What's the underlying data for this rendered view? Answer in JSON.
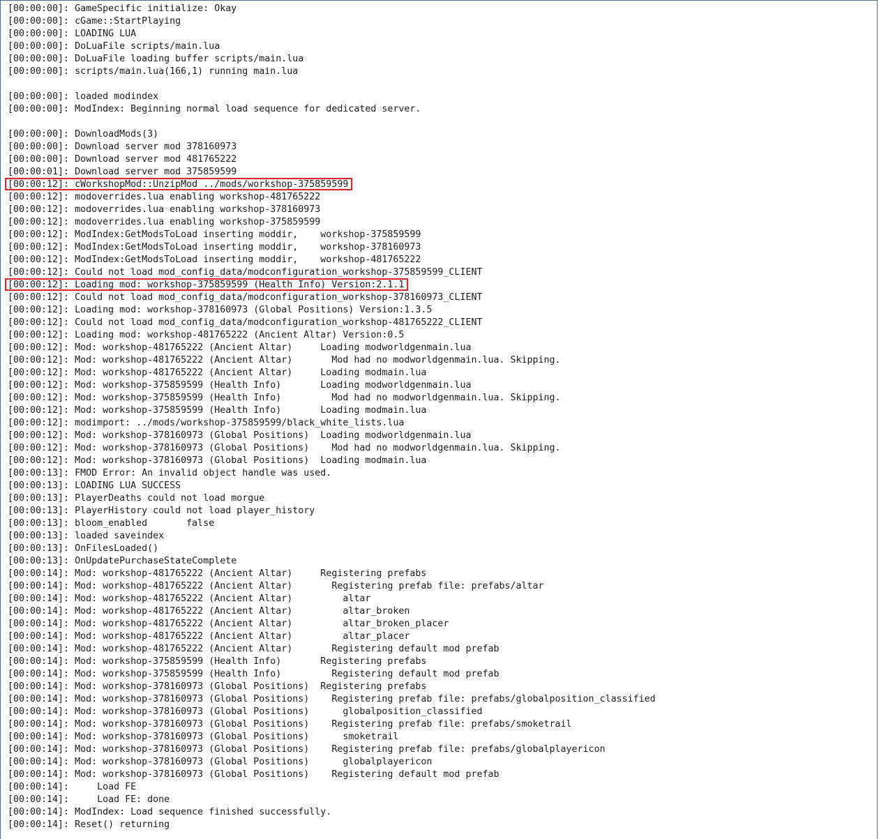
{
  "console": {
    "lines": [
      "[00:00:00]: GameSpecific initialize: Okay",
      "[00:00:00]: cGame::StartPlaying",
      "[00:00:00]: LOADING LUA",
      "[00:00:00]: DoLuaFile scripts/main.lua",
      "[00:00:00]: DoLuaFile loading buffer scripts/main.lua",
      "[00:00:00]: scripts/main.lua(166,1) running main.lua",
      "",
      "[00:00:00]: loaded modindex",
      "[00:00:00]: ModIndex: Beginning normal load sequence for dedicated server.",
      "",
      "[00:00:00]: DownloadMods(3)",
      "[00:00:00]: Download server mod 378160973",
      "[00:00:00]: Download server mod 481765222",
      "[00:00:01]: Download server mod 375859599",
      "[00:00:12]: cWorkshopMod::UnzipMod ../mods/workshop-375859599",
      "[00:00:12]: modoverrides.lua enabling workshop-481765222",
      "[00:00:12]: modoverrides.lua enabling workshop-378160973",
      "[00:00:12]: modoverrides.lua enabling workshop-375859599",
      "[00:00:12]: ModIndex:GetModsToLoad inserting moddir,    workshop-375859599",
      "[00:00:12]: ModIndex:GetModsToLoad inserting moddir,    workshop-378160973",
      "[00:00:12]: ModIndex:GetModsToLoad inserting moddir,    workshop-481765222",
      "[00:00:12]: Could not load mod_config_data/modconfiguration_workshop-375859599_CLIENT",
      "[00:00:12]: Loading mod: workshop-375859599 (Health Info) Version:2.1.1",
      "[00:00:12]: Could not load mod_config_data/modconfiguration_workshop-378160973_CLIENT",
      "[00:00:12]: Loading mod: workshop-378160973 (Global Positions) Version:1.3.5",
      "[00:00:12]: Could not load mod_config_data/modconfiguration_workshop-481765222_CLIENT",
      "[00:00:12]: Loading mod: workshop-481765222 (Ancient Altar) Version:0.5",
      "[00:00:12]: Mod: workshop-481765222 (Ancient Altar)     Loading modworldgenmain.lua",
      "[00:00:12]: Mod: workshop-481765222 (Ancient Altar)       Mod had no modworldgenmain.lua. Skipping.",
      "[00:00:12]: Mod: workshop-481765222 (Ancient Altar)     Loading modmain.lua",
      "[00:00:12]: Mod: workshop-375859599 (Health Info)       Loading modworldgenmain.lua",
      "[00:00:12]: Mod: workshop-375859599 (Health Info)         Mod had no modworldgenmain.lua. Skipping.",
      "[00:00:12]: Mod: workshop-375859599 (Health Info)       Loading modmain.lua",
      "[00:00:12]: modimport: ../mods/workshop-375859599/black_white_lists.lua",
      "[00:00:12]: Mod: workshop-378160973 (Global Positions)  Loading modworldgenmain.lua",
      "[00:00:12]: Mod: workshop-378160973 (Global Positions)    Mod had no modworldgenmain.lua. Skipping.",
      "[00:00:12]: Mod: workshop-378160973 (Global Positions)  Loading modmain.lua",
      "[00:00:13]: FMOD Error: An invalid object handle was used.",
      "[00:00:13]: LOADING LUA SUCCESS",
      "[00:00:13]: PlayerDeaths could not load morgue",
      "[00:00:13]: PlayerHistory could not load player_history",
      "[00:00:13]: bloom_enabled       false",
      "[00:00:13]: loaded saveindex",
      "[00:00:13]: OnFilesLoaded()",
      "[00:00:13]: OnUpdatePurchaseStateComplete",
      "[00:00:14]: Mod: workshop-481765222 (Ancient Altar)     Registering prefabs",
      "[00:00:14]: Mod: workshop-481765222 (Ancient Altar)       Registering prefab file: prefabs/altar",
      "[00:00:14]: Mod: workshop-481765222 (Ancient Altar)         altar",
      "[00:00:14]: Mod: workshop-481765222 (Ancient Altar)         altar_broken",
      "[00:00:14]: Mod: workshop-481765222 (Ancient Altar)         altar_broken_placer",
      "[00:00:14]: Mod: workshop-481765222 (Ancient Altar)         altar_placer",
      "[00:00:14]: Mod: workshop-481765222 (Ancient Altar)       Registering default mod prefab",
      "[00:00:14]: Mod: workshop-375859599 (Health Info)       Registering prefabs",
      "[00:00:14]: Mod: workshop-375859599 (Health Info)         Registering default mod prefab",
      "[00:00:14]: Mod: workshop-378160973 (Global Positions)  Registering prefabs",
      "[00:00:14]: Mod: workshop-378160973 (Global Positions)    Registering prefab file: prefabs/globalposition_classified",
      "[00:00:14]: Mod: workshop-378160973 (Global Positions)      globalposition_classified",
      "[00:00:14]: Mod: workshop-378160973 (Global Positions)    Registering prefab file: prefabs/smoketrail",
      "[00:00:14]: Mod: workshop-378160973 (Global Positions)      smoketrail",
      "[00:00:14]: Mod: workshop-378160973 (Global Positions)    Registering prefab file: prefabs/globalplayericon",
      "[00:00:14]: Mod: workshop-378160973 (Global Positions)      globalplayericon",
      "[00:00:14]: Mod: workshop-378160973 (Global Positions)    Registering default mod prefab",
      "[00:00:14]:     Load FE",
      "[00:00:14]:     Load FE: done",
      "[00:00:14]: ModIndex: Load sequence finished successfully.",
      "[00:00:14]: Reset() returning"
    ],
    "highlighted_lines": [
      14,
      22
    ],
    "highlight_color": "#d9262c",
    "text_color": "#1a1a1a",
    "background_color": "#ffffff"
  }
}
